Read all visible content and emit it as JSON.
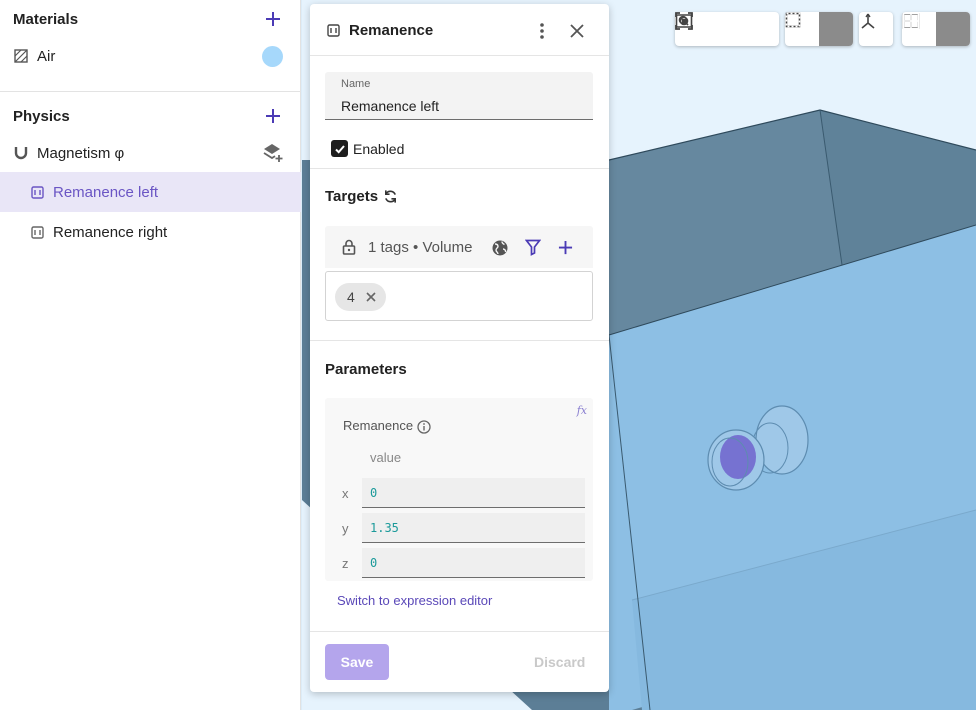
{
  "sidebar": {
    "materials": {
      "title": "Materials",
      "items": [
        {
          "label": "Air",
          "color": "#a6d8fb"
        }
      ]
    },
    "physics": {
      "title": "Physics",
      "items": [
        {
          "label": "Magnetism φ",
          "icon": "magnet-icon",
          "action_icon": "add-layer-icon"
        },
        {
          "label": "Remanence left",
          "icon": "condition-icon",
          "selected": true
        },
        {
          "label": "Remanence right",
          "icon": "condition-icon",
          "selected": false
        }
      ]
    }
  },
  "panel": {
    "title": "Remanence",
    "name_field": {
      "label": "Name",
      "value": "Remanence left"
    },
    "enabled": {
      "label": "Enabled",
      "checked": true
    },
    "targets": {
      "title": "Targets",
      "summary": "1 tags • Volume",
      "tags": [
        "4"
      ]
    },
    "parameters": {
      "title": "Parameters",
      "remanence": {
        "label": "Remanence",
        "column_header": "value",
        "rows": [
          {
            "axis": "x",
            "value": "0"
          },
          {
            "axis": "y",
            "value": "1.35"
          },
          {
            "axis": "z",
            "value": "0"
          }
        ]
      },
      "expression_link": "Switch to expression editor"
    },
    "footer": {
      "save": "Save",
      "discard": "Discard"
    }
  },
  "viewport": {
    "toolbar": {
      "groups": [
        [
          "focus-selection-icon",
          "zoom-fit-icon",
          "frame-icon"
        ],
        [
          "solid-view-icon",
          "wireframe-view-icon"
        ],
        [
          "axes-icon"
        ],
        [
          "section-view-icon",
          "grid-layout-icon"
        ]
      ],
      "active": [
        "wireframe-view-icon",
        "grid-layout-icon"
      ]
    },
    "colors": {
      "box_face": "#8dbfe4",
      "box_top": "#5b7f97",
      "magnet": "#6f63cc"
    }
  },
  "colors": {
    "accent": "#5a48b8",
    "selected_bg": "#e9e6f7"
  }
}
